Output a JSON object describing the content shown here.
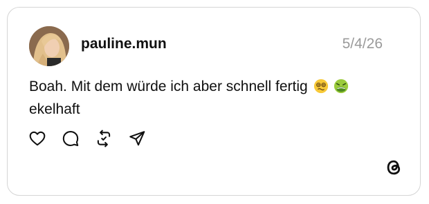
{
  "post": {
    "username": "pauline.mun",
    "timestamp": "5/4/26",
    "text": "Boah. Mit dem würde ich aber schnell fertig",
    "text_continued": "ekelhaft"
  },
  "icons": {
    "avatar": "profile-photo",
    "emoji_1": "woozy-dizzy-face-emoji",
    "emoji_2": "nauseated-face-emoji",
    "like": "heart-icon",
    "reply": "comment-bubble-icon",
    "repost": "repost-icon",
    "share": "send-icon",
    "logo": "threads-logo"
  },
  "colors": {
    "text": "#101010",
    "timestamp": "#9a9a9a",
    "border": "#d5d5d5"
  }
}
